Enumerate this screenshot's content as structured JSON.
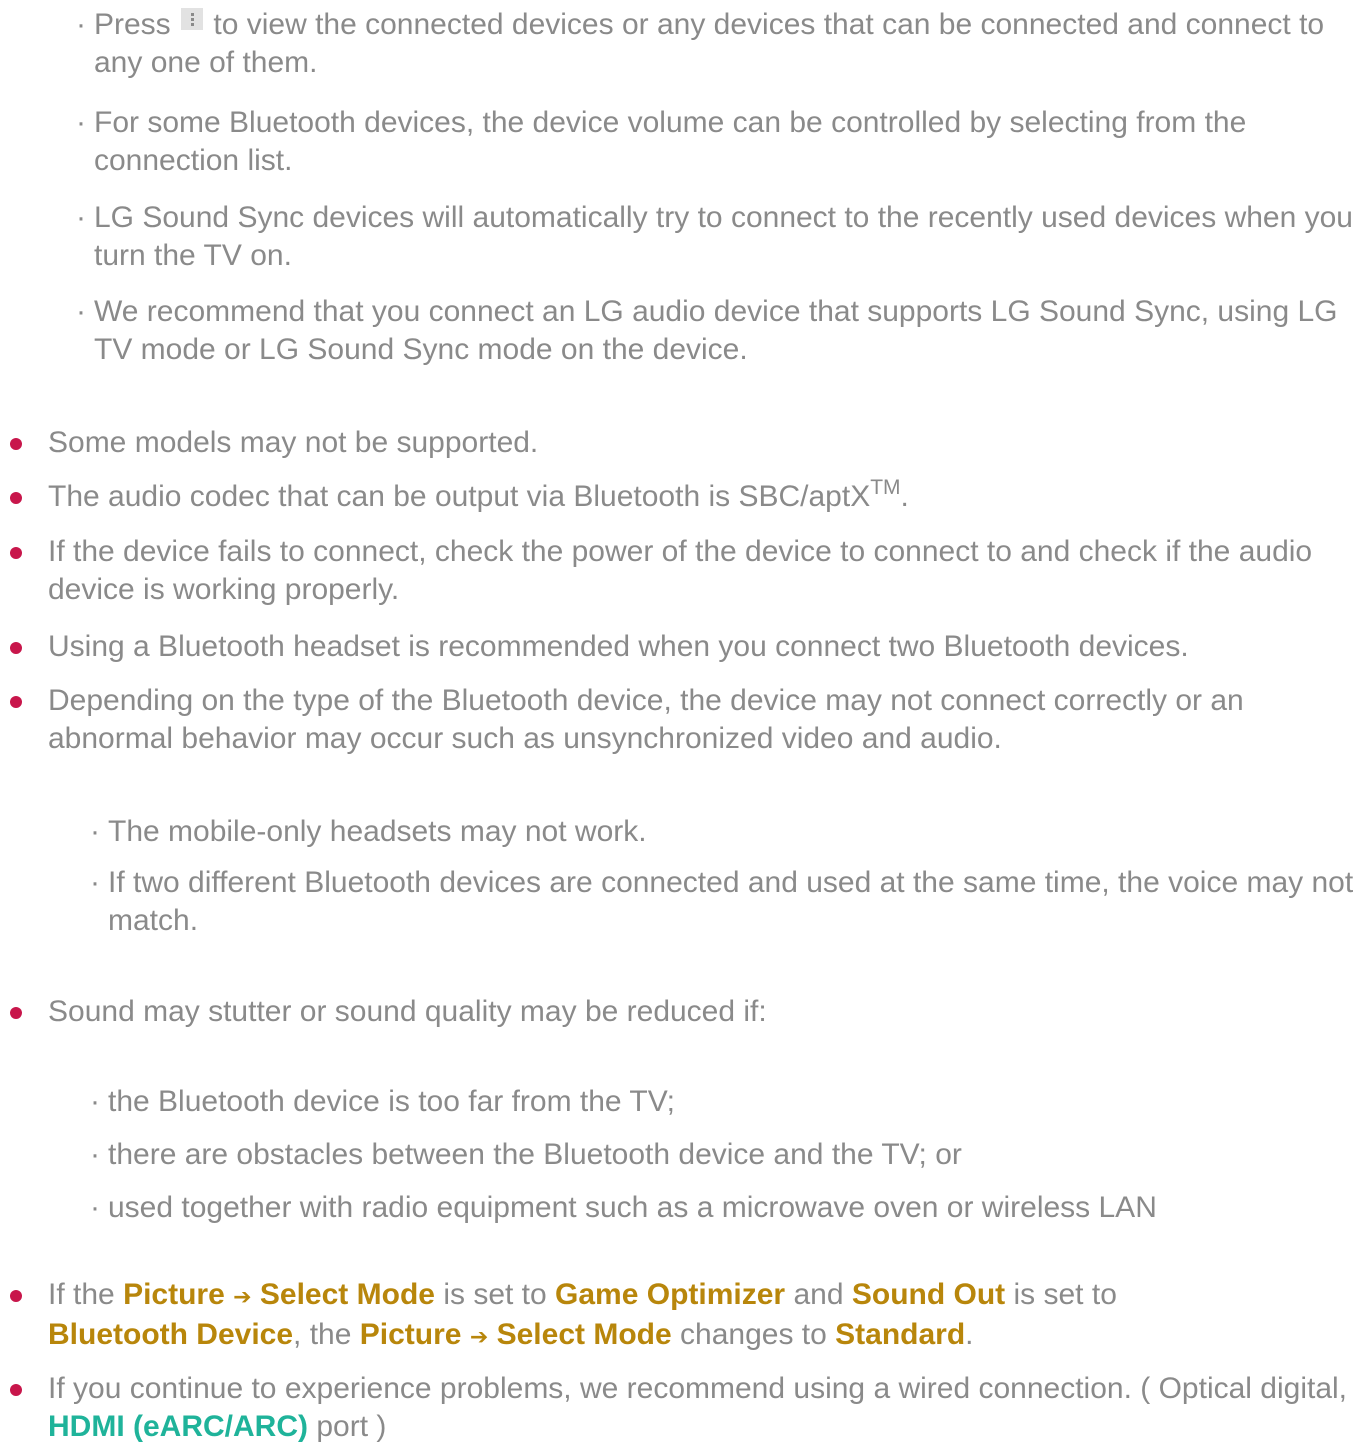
{
  "sub_top": [
    {
      "pre": "Press",
      "post": "to view the connected devices or any devices that can be connected and connect to any one of them."
    },
    {
      "text": "For some Bluetooth devices, the device volume can be controlled by selecting from the connection list."
    },
    {
      "text": "LG Sound Sync devices will automatically try to connect to the recently used devices when you turn the TV on."
    },
    {
      "text": "We recommend that you connect an LG audio device that supports LG Sound Sync, using LG TV mode or LG Sound Sync mode on the device."
    }
  ],
  "bullets": {
    "b1": "Some models may not be supported.",
    "b2_pre": "The audio codec that can be output via Bluetooth is SBC/aptX",
    "b2_sup": "TM",
    "b2_post": ".",
    "b3": "If the device fails to connect, check the power of the device to connect to and check if the audio device is working properly.",
    "b4": "Using a Bluetooth headset is recommended when you connect two Bluetooth devices.",
    "b5": "Depending on the type of the Bluetooth device, the device may not connect correctly or an abnormal behavior may occur such as unsynchronized video and audio.",
    "b6": "Sound may stutter or sound quality may be reduced if:",
    "b7": {
      "t1": "If the",
      "picture": "Picture",
      "arrow": "➔",
      "select_mode": "Select Mode",
      "t2": "is set to",
      "game_optimizer": "Game Optimizer",
      "t3": "and",
      "sound_out": "Sound Out",
      "t4": "is set to",
      "bluetooth_device": "Bluetooth Device",
      "t5": ", the",
      "picture2": "Picture",
      "select_mode2": "Select Mode",
      "t6": "changes to",
      "standard": "Standard",
      "t7": "."
    },
    "b8": {
      "t1": "If you continue to experience problems, we recommend using a wired connection. ( Optical digital,",
      "hdmi": "HDMI (eARC/ARC)",
      "t2": "port )"
    }
  },
  "sub_headset": [
    "The mobile-only headsets may not work.",
    "If two different Bluetooth devices are connected and used at the same time, the voice may not match."
  ],
  "sub_stutter": [
    "the Bluetooth device is too far from the TV;",
    "there are obstacles between the Bluetooth device and the TV; or",
    "used together with radio equipment such as a microwave oven or wireless LAN"
  ],
  "sub_marker": "·",
  "colors": {
    "text": "#8a8a8a",
    "bullet": "#c8164b",
    "highlight": "#b8860b",
    "highlight_alt": "#1fb39a"
  },
  "icons": {
    "more": "more-vertical-icon"
  }
}
